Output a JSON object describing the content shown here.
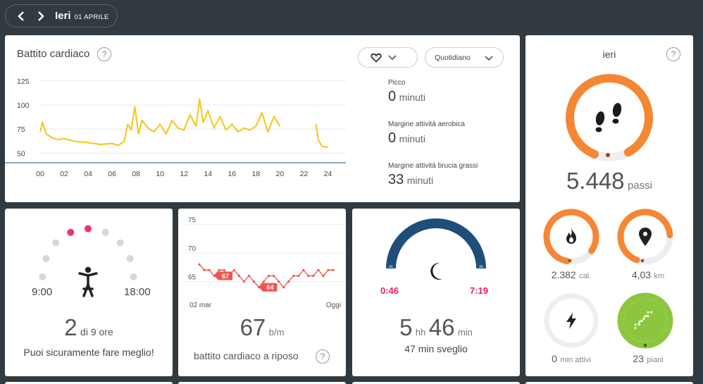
{
  "nav": {
    "day": "Ieri",
    "date": "01 APRILE"
  },
  "heart": {
    "title": "Battito cardiaco",
    "help": "?",
    "period_select": "Quotidiano",
    "y_ticks": [
      "125",
      "100",
      "75",
      "50"
    ],
    "x_ticks": [
      "00",
      "02",
      "04",
      "06",
      "08",
      "10",
      "12",
      "14",
      "16",
      "18",
      "20",
      "22",
      "24"
    ],
    "zones": [
      {
        "label": "Picco",
        "value": "0",
        "unit": "minuti"
      },
      {
        "label": "Margine attività aerobica",
        "value": "0",
        "unit": "minuti"
      },
      {
        "label": "Margine attività brucia grassi",
        "value": "33",
        "unit": "minuti"
      }
    ],
    "line_color": "#f5c518"
  },
  "hourly": {
    "left_time": "9:00",
    "right_time": "18:00",
    "value": "2",
    "suffix": "di 9 ore",
    "message": "Puoi sicuramente fare meglio!"
  },
  "resting": {
    "y_ticks": [
      "75",
      "70",
      "65"
    ],
    "x_start": "02 mar",
    "x_end": "Oggi",
    "flag_high": "67",
    "flag_low": "64",
    "value": "67",
    "unit": "b/m",
    "label": "battito cardiaco a riposo",
    "help": "?",
    "line_color": "#f0544f"
  },
  "sleep": {
    "start": "0:46",
    "end": "7:19",
    "hours": "5",
    "hours_unit": "hh",
    "mins": "46",
    "mins_unit": "min",
    "awake": "47 min sveglio"
  },
  "summary": {
    "title": "ieri",
    "help": "?",
    "steps": "5.448",
    "steps_unit": "passi",
    "calories": "2.382",
    "calories_unit": "cal.",
    "distance": "4,03",
    "distance_unit": "km",
    "active": "0",
    "active_unit": "min attivi",
    "floors": "23",
    "floors_unit": "piani",
    "accent": "#f58634",
    "goal_color": "#8cc63f"
  },
  "chart_data": [
    {
      "type": "line",
      "title": "Battito cardiaco",
      "xlabel": "",
      "ylabel": "",
      "x": [
        0,
        0.2,
        0.5,
        1,
        1.5,
        2,
        3,
        4,
        5,
        6,
        6.5,
        7,
        7.3,
        7.6,
        7.9,
        8.2,
        8.5,
        9,
        9.5,
        10,
        10.5,
        11,
        11.5,
        12,
        12.5,
        13,
        13.3,
        13.6,
        14,
        14.5,
        15,
        15.5,
        16,
        16.5,
        17,
        17.5,
        18,
        18.5,
        19,
        19.5,
        20
      ],
      "y": [
        72,
        82,
        70,
        66,
        64,
        65,
        62,
        61,
        59,
        60,
        58,
        62,
        80,
        74,
        98,
        70,
        84,
        76,
        72,
        80,
        70,
        84,
        76,
        74,
        90,
        78,
        106,
        82,
        94,
        76,
        88,
        74,
        80,
        72,
        76,
        74,
        78,
        92,
        72,
        88,
        78
      ],
      "segment2_x": [
        23,
        23.2,
        23.5,
        24
      ],
      "segment2_y": [
        80,
        64,
        57,
        56
      ],
      "ylim": [
        40,
        130
      ],
      "xlim": [
        0,
        25.5
      ]
    },
    {
      "type": "line",
      "title": "battito cardiaco a riposo",
      "x_labels": [
        "02 mar",
        "Oggi"
      ],
      "values": [
        68,
        67,
        67,
        66,
        67,
        67,
        66,
        67,
        66,
        65,
        66,
        65,
        64,
        65,
        66,
        66,
        65,
        64,
        65,
        66,
        66,
        67,
        66,
        66,
        67,
        66,
        67,
        67
      ],
      "ylim": [
        62,
        77
      ]
    }
  ]
}
